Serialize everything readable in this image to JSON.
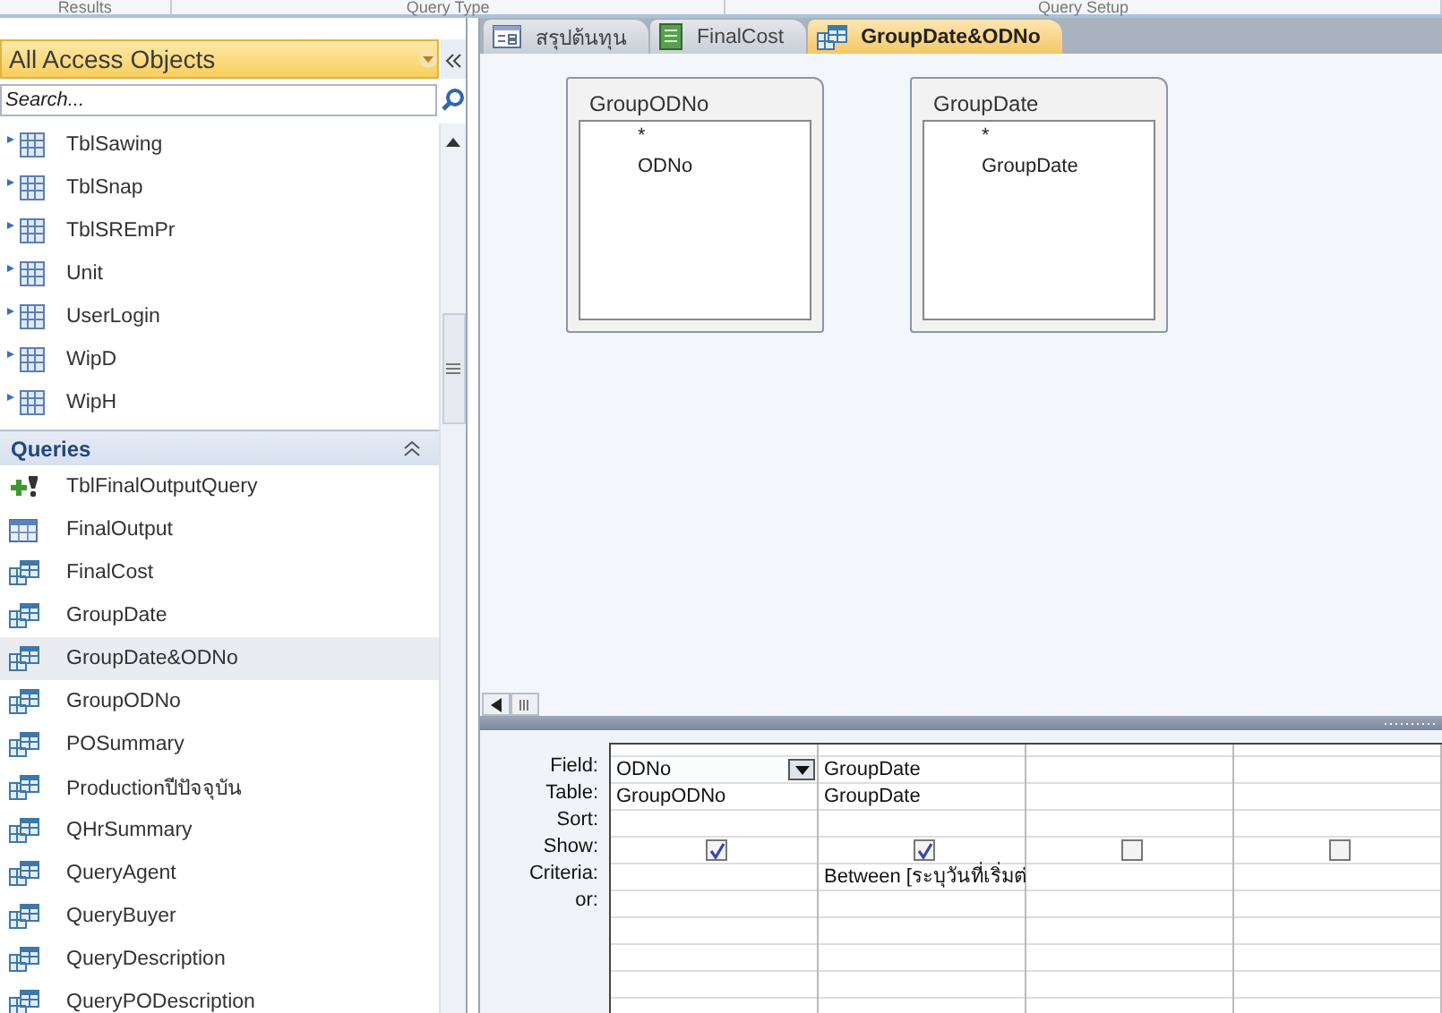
{
  "ribbon_groups": [
    "Results",
    "Query Type",
    "Query Setup"
  ],
  "nav_pane": {
    "title": "All Access Objects",
    "search": {
      "placeholder": "Search..."
    },
    "tables": [
      "TblSawing",
      "TblSnap",
      "TblSREmPr",
      "Unit",
      "UserLogin",
      "WipD",
      "WipH"
    ],
    "queries": {
      "title": "Queries",
      "expanded": true,
      "items": [
        {
          "name": "TblFinalOutputQuery",
          "kind": "make_table",
          "selected": false
        },
        {
          "name": "FinalOutput",
          "kind": "datasheet",
          "selected": false
        },
        {
          "name": "FinalCost",
          "kind": "select",
          "selected": false
        },
        {
          "name": "GroupDate",
          "kind": "select",
          "selected": false
        },
        {
          "name": "GroupDate&ODNo",
          "kind": "select",
          "selected": true
        },
        {
          "name": "GroupODNo",
          "kind": "select",
          "selected": false
        },
        {
          "name": "POSummary",
          "kind": "select",
          "selected": false
        },
        {
          "name": "Productionปีปัจจุบัน",
          "kind": "select",
          "selected": false
        },
        {
          "name": "QHrSummary",
          "kind": "select",
          "selected": false
        },
        {
          "name": "QueryAgent",
          "kind": "select",
          "selected": false
        },
        {
          "name": "QueryBuyer",
          "kind": "select",
          "selected": false
        },
        {
          "name": "QueryDescription",
          "kind": "select",
          "selected": false
        },
        {
          "name": "QueryPODescription",
          "kind": "select",
          "selected": false
        }
      ]
    }
  },
  "tabs": [
    {
      "label": "สรุปต้นทุน",
      "kind": "form",
      "selected": false
    },
    {
      "label": "FinalCost",
      "kind": "report",
      "selected": false
    },
    {
      "label": "GroupDate&ODNo",
      "kind": "query",
      "selected": true
    }
  ],
  "field_lists": [
    {
      "title": "GroupODNo",
      "fields": [
        "*",
        "ODNo"
      ]
    },
    {
      "title": "GroupDate",
      "fields": [
        "*",
        "GroupDate"
      ]
    }
  ],
  "design_grid": {
    "row_labels": [
      "Field:",
      "Table:",
      "Sort:",
      "Show:",
      "Criteria:",
      "or:"
    ],
    "columns": [
      {
        "field": "ODNo",
        "table": "GroupODNo",
        "show": true,
        "focused": true
      },
      {
        "field": "GroupDate",
        "table": "GroupDate",
        "show": true,
        "focused": false,
        "criteria": "Between [ระบุวันที่เริ่มต่"
      },
      {
        "show": false,
        "focused": false
      },
      {
        "show": false,
        "focused": false
      }
    ]
  }
}
